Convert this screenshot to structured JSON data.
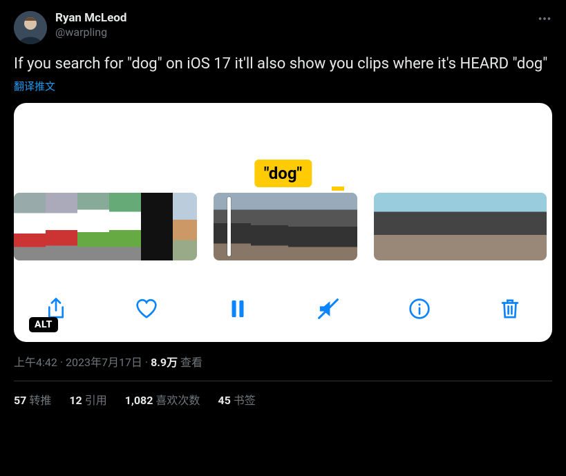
{
  "user": {
    "display_name": "Ryan McLeod",
    "handle": "@warpling"
  },
  "tweet_text": "If you search for \"dog\" on iOS 17 it'll also show you clips where it's HEARD \"dog\"",
  "translate_label": "翻译推文",
  "media": {
    "caption_text": "\"dog\"",
    "alt_badge": "ALT"
  },
  "timestamp": {
    "time": "上午4:42",
    "date": "2023年7月17日",
    "views_count": "8.9万",
    "views_label": "查看",
    "dot": " · "
  },
  "stats": {
    "retweets_count": "57",
    "retweets_label": "转推",
    "quotes_count": "12",
    "quotes_label": "引用",
    "likes_count": "1,082",
    "likes_label": "喜欢次数",
    "bookmarks_count": "45",
    "bookmarks_label": "书签"
  }
}
